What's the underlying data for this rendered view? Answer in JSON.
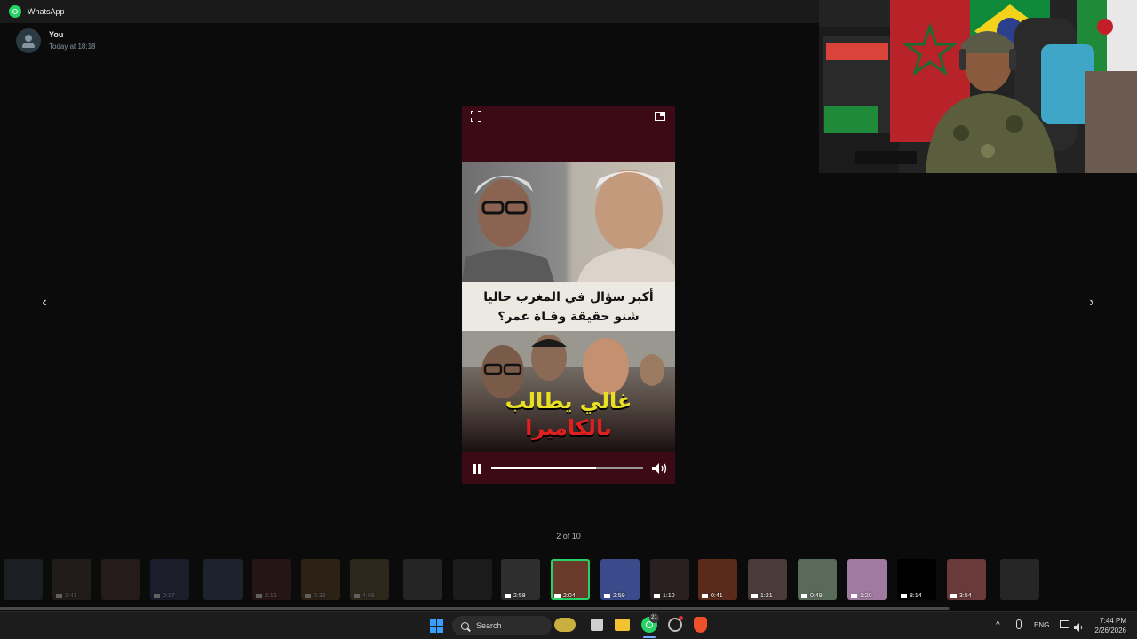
{
  "window": {
    "title": "WhatsApp"
  },
  "sender": {
    "name": "You",
    "timestamp": "Today at 18:18"
  },
  "viewer": {
    "caption_line1": "أكبر سؤال في المغرب حاليا",
    "caption_line2": "شنو حقيقة وفـاة عمر؟",
    "headline_line1": "غالي يطالب",
    "headline_line2": "بالكاميرا",
    "progress_fraction": 0.69,
    "counter": "2 of 10"
  },
  "thumbnails": [
    {
      "duration": "",
      "state": "dim",
      "color": "#3a4250"
    },
    {
      "duration": "2:41",
      "state": "dim",
      "color": "#4a3a36"
    },
    {
      "duration": "",
      "state": "dim",
      "color": "#5a3a3a"
    },
    {
      "duration": "0:17",
      "state": "dim",
      "color": "#3b3f66"
    },
    {
      "duration": "",
      "state": "dim",
      "color": "#40506a"
    },
    {
      "duration": "2:16",
      "state": "dim",
      "color": "#5a2a2a"
    },
    {
      "duration": "2:33",
      "state": "dim",
      "color": "#6a4a2a"
    },
    {
      "duration": "4:09",
      "state": "dim",
      "color": "#6a5a3a"
    },
    {
      "duration": "",
      "state": "dim",
      "color": "#555555"
    },
    {
      "duration": "",
      "state": "dim",
      "color": "#3a3a3a"
    },
    {
      "duration": "2:58",
      "state": "normal",
      "color": "#2e2e2e"
    },
    {
      "duration": "2:04",
      "state": "active",
      "color": "#6a3a2a"
    },
    {
      "duration": "2:59",
      "state": "normal",
      "color": "#3a4a8a"
    },
    {
      "duration": "1:10",
      "state": "normal",
      "color": "#2a2020"
    },
    {
      "duration": "0:41",
      "state": "normal",
      "color": "#5a2a1a"
    },
    {
      "duration": "1:21",
      "state": "normal",
      "color": "#4a3a3a"
    },
    {
      "duration": "0:49",
      "state": "normal",
      "color": "#5a6a5a"
    },
    {
      "duration": "1:20",
      "state": "normal",
      "color": "#a07aa0"
    },
    {
      "duration": "8:14",
      "state": "normal",
      "color": "#000000"
    },
    {
      "duration": "3:54",
      "state": "normal",
      "color": "#6a3a3a"
    },
    {
      "duration": "",
      "state": "dim",
      "color": "#5a5a5a"
    }
  ],
  "taskbar": {
    "search_label": "Search",
    "whatsapp_badge": "21",
    "language": "ENG",
    "time": "7:44 PM",
    "date": "2/26/2026"
  },
  "icons": {
    "prev": "chevron-left-icon",
    "next": "chevron-right-icon",
    "fullscreen": "fullscreen-icon",
    "pip": "picture-in-picture-icon",
    "pause": "pause-icon",
    "volume": "volume-icon"
  },
  "colors": {
    "whatsapp_green": "#25d366",
    "viewer_bg": "#3b0a15"
  }
}
